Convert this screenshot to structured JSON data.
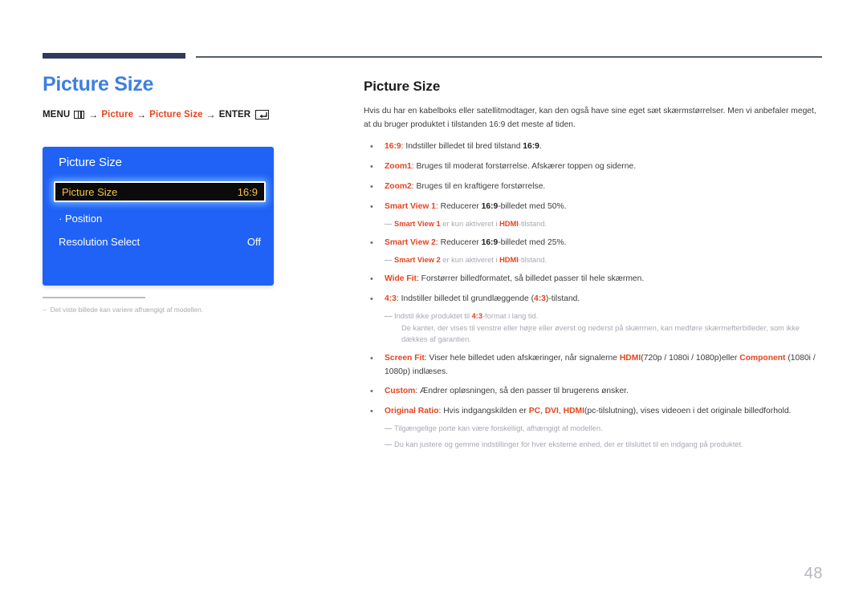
{
  "page": {
    "number": "48"
  },
  "left": {
    "title": "Picture Size",
    "menu_path": {
      "menu_label": "MENU",
      "menu_icon": "menu-icon",
      "arrow": "→",
      "step1": "Picture",
      "step2": "Picture Size",
      "enter_label": "ENTER",
      "enter_icon": "enter-icon"
    },
    "osd": {
      "title": "Picture Size",
      "rows": [
        {
          "label": "Picture Size",
          "value": "16:9",
          "selected": true
        },
        {
          "label": "· Position",
          "value": "",
          "selected": false
        },
        {
          "label": "Resolution Select",
          "value": "Off",
          "selected": false
        }
      ]
    },
    "note": {
      "dash": "–",
      "text": "Det viste billede kan variere afhængigt af modellen."
    }
  },
  "right": {
    "title": "Picture Size",
    "intro": "Hvis du har en kabelboks eller satellitmodtager, kan den også have sine eget sæt skærmstørrelser. Men vi anbefaler meget, at du bruger produktet i tilstanden 16:9 det meste af tiden.",
    "bullet_marker": "•",
    "note_dash": "—",
    "items": [
      {
        "kind": "bullet",
        "parts": [
          {
            "t": "16:9",
            "s": "accent"
          },
          {
            "t": ": Indstiller billedet til bred tilstand ",
            "s": "plain"
          },
          {
            "t": "16:9",
            "s": "bold"
          },
          {
            "t": ".",
            "s": "plain"
          }
        ]
      },
      {
        "kind": "bullet",
        "parts": [
          {
            "t": "Zoom1",
            "s": "accent"
          },
          {
            "t": ": Bruges til moderat forstørrelse. Afskærer toppen og siderne.",
            "s": "plain"
          }
        ]
      },
      {
        "kind": "bullet",
        "parts": [
          {
            "t": "Zoom2",
            "s": "accent"
          },
          {
            "t": ": Bruges til en kraftigere forstørrelse.",
            "s": "plain"
          }
        ]
      },
      {
        "kind": "bullet",
        "parts": [
          {
            "t": "Smart View 1",
            "s": "accent"
          },
          {
            "t": ": Reducerer ",
            "s": "plain"
          },
          {
            "t": "16:9",
            "s": "bold"
          },
          {
            "t": "-billedet med 50%.",
            "s": "plain"
          }
        ]
      },
      {
        "kind": "note",
        "parts": [
          {
            "t": "Smart View 1",
            "s": "accent"
          },
          {
            "t": " er kun aktiveret i ",
            "s": "plain"
          },
          {
            "t": "HDMI",
            "s": "accent"
          },
          {
            "t": "-tilstand.",
            "s": "plain"
          }
        ]
      },
      {
        "kind": "bullet",
        "parts": [
          {
            "t": "Smart View 2",
            "s": "accent"
          },
          {
            "t": ": Reducerer ",
            "s": "plain"
          },
          {
            "t": "16:9",
            "s": "bold"
          },
          {
            "t": "-billedet med 25%.",
            "s": "plain"
          }
        ]
      },
      {
        "kind": "note",
        "parts": [
          {
            "t": "Smart View 2",
            "s": "accent"
          },
          {
            "t": " er kun aktiveret i ",
            "s": "plain"
          },
          {
            "t": "HDMI",
            "s": "accent"
          },
          {
            "t": "-tilstand.",
            "s": "plain"
          }
        ]
      },
      {
        "kind": "bullet",
        "parts": [
          {
            "t": "Wide Fit",
            "s": "accent"
          },
          {
            "t": ": Forstørrer billedformatet, så billedet passer til hele skærmen.",
            "s": "plain"
          }
        ]
      },
      {
        "kind": "bullet",
        "parts": [
          {
            "t": "4:3",
            "s": "accent"
          },
          {
            "t": ": Indstiller billedet til grundlæggende (",
            "s": "plain"
          },
          {
            "t": "4:3",
            "s": "accent"
          },
          {
            "t": ")-tilstand.",
            "s": "plain"
          }
        ]
      },
      {
        "kind": "note",
        "parts": [
          {
            "t": "Indstil ikke produktet til ",
            "s": "plain"
          },
          {
            "t": "4:3",
            "s": "accent"
          },
          {
            "t": "-format i lang tid.",
            "s": "plain"
          },
          {
            "t": "De kanter, der vises til venstre eller højre eller øverst og nederst på skærmen, kan medføre skærmefterbilleder, som ikke dækkes af garantien.",
            "s": "sub"
          }
        ]
      },
      {
        "kind": "bullet",
        "parts": [
          {
            "t": "Screen Fit",
            "s": "accent"
          },
          {
            "t": ": Viser hele billedet uden afskæringer, når signalerne ",
            "s": "plain"
          },
          {
            "t": "HDMI",
            "s": "accent"
          },
          {
            "t": "(720p / 1080i / 1080p)eller ",
            "s": "plain"
          },
          {
            "t": "Component",
            "s": "accent"
          },
          {
            "t": " (1080i / 1080p) indlæses.",
            "s": "plain"
          }
        ]
      },
      {
        "kind": "bullet",
        "parts": [
          {
            "t": "Custom",
            "s": "accent"
          },
          {
            "t": ": Ændrer opløsningen, så den passer til brugerens ønsker.",
            "s": "plain"
          }
        ]
      },
      {
        "kind": "bullet",
        "parts": [
          {
            "t": "Original Ratio",
            "s": "accent"
          },
          {
            "t": ": Hvis indgangskilden er ",
            "s": "plain"
          },
          {
            "t": "PC",
            "s": "accent"
          },
          {
            "t": ", ",
            "s": "plain"
          },
          {
            "t": "DVI",
            "s": "accent"
          },
          {
            "t": ", ",
            "s": "plain"
          },
          {
            "t": "HDMI",
            "s": "accent"
          },
          {
            "t": "(pc-tilslutning), vises videoen i det originale billedforhold.",
            "s": "plain"
          }
        ]
      },
      {
        "kind": "note",
        "parts": [
          {
            "t": "Tilgængelige porte kan være forskelligt, afhængigt af modellen.",
            "s": "plain"
          }
        ]
      },
      {
        "kind": "note",
        "parts": [
          {
            "t": "Du kan justere og gemme indstillinger for hver eksterne enhed, der er tilsluttet til en indgang på produktet.",
            "s": "plain"
          }
        ]
      }
    ]
  },
  "colors": {
    "accent_red": "#e5441e",
    "heading_blue": "#3e7fe0",
    "osd_blue": "#1f62f5",
    "osd_highlight_text": "#f3c33c",
    "rule_dark": "#2f3a5c",
    "note_gray": "#a8a9b2"
  }
}
